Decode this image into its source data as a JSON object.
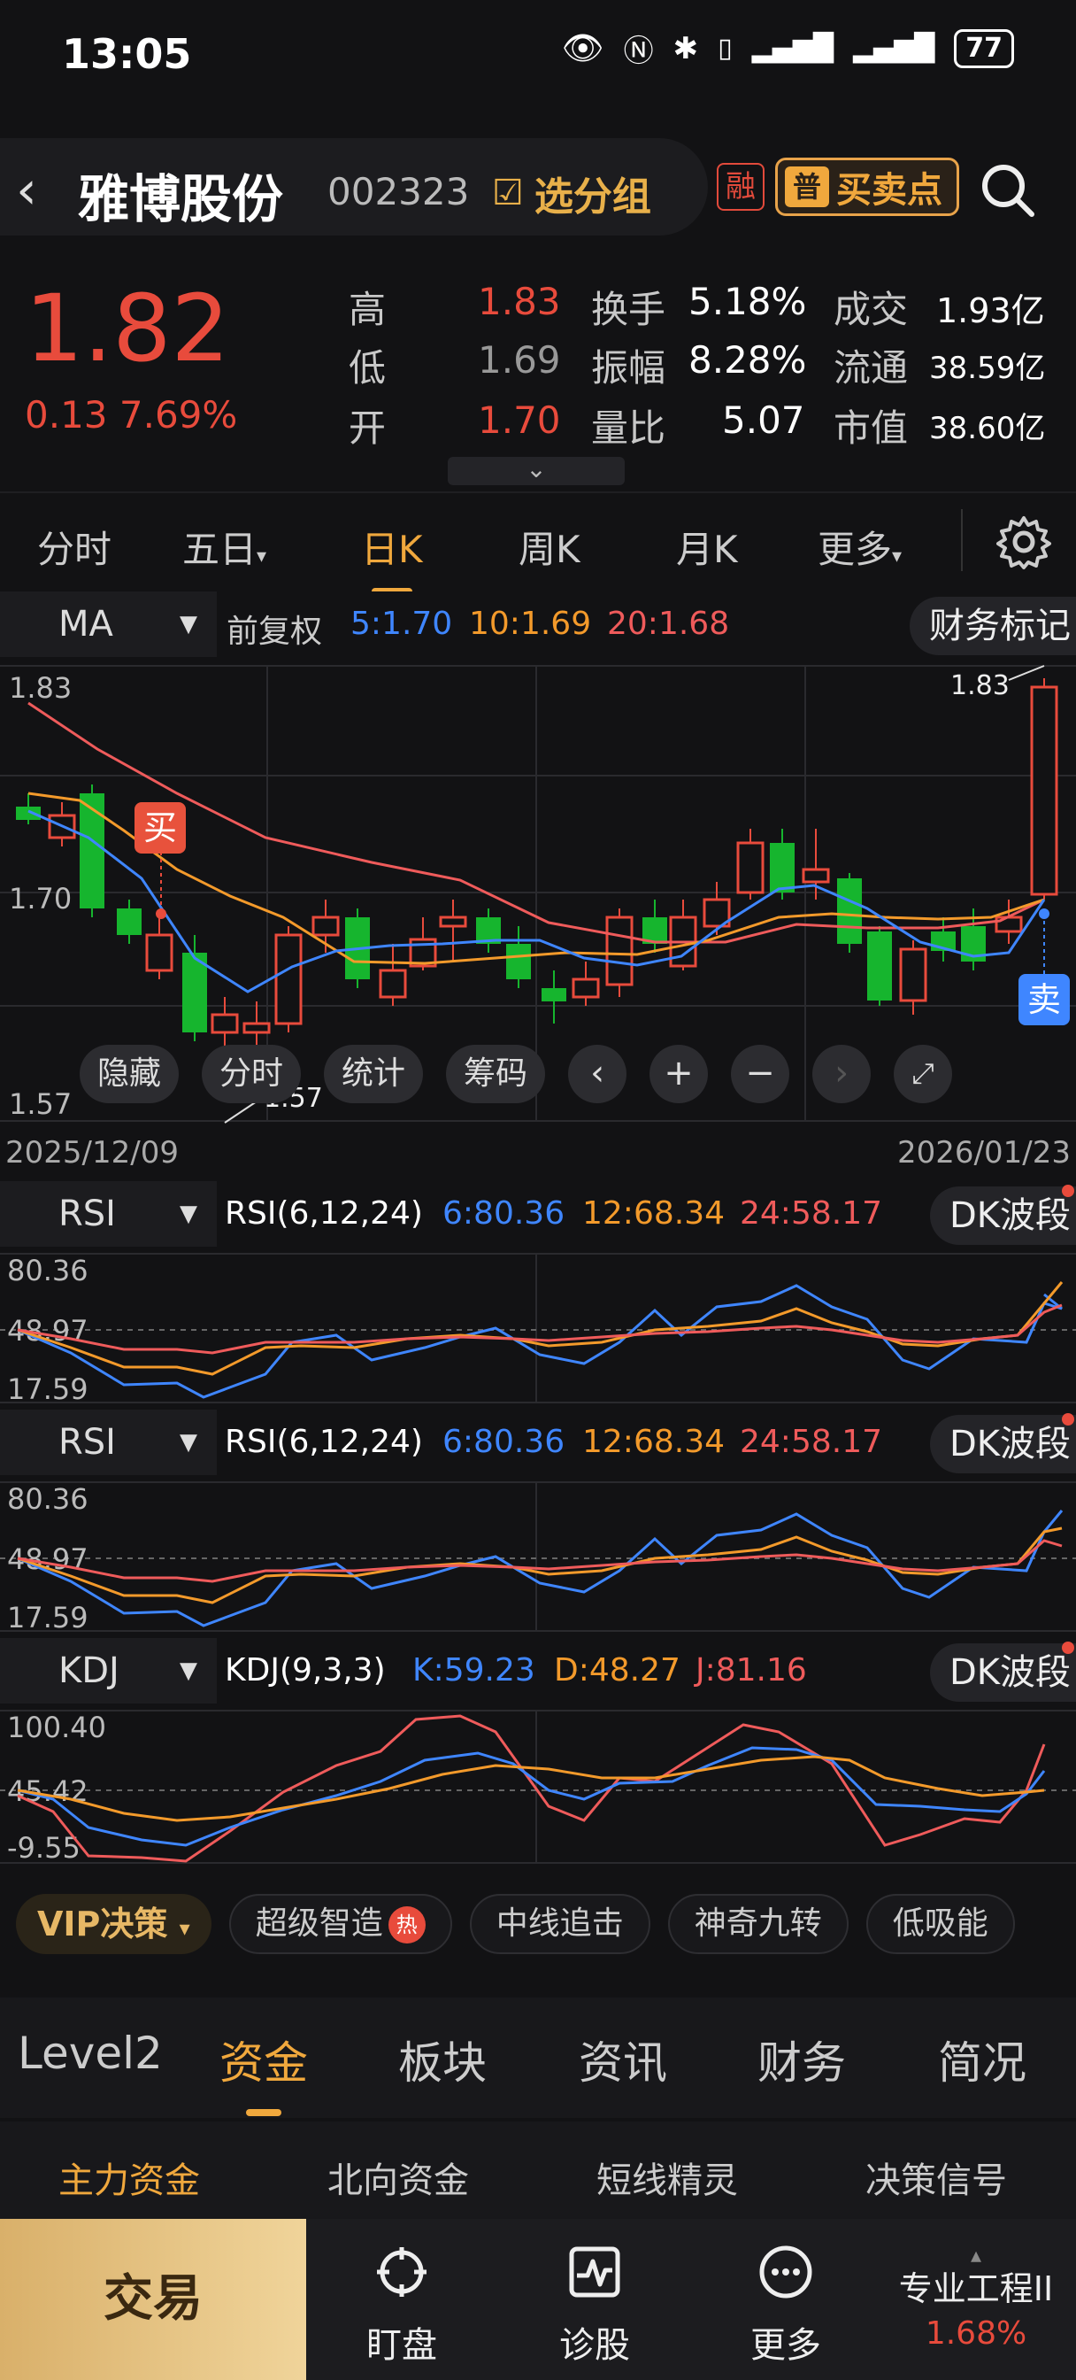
{
  "status_bar": {
    "time": "13:05",
    "battery": "77"
  },
  "header": {
    "stock_name": "雅博股份",
    "stock_code": "002323",
    "group_button": "选分组",
    "margin_badge": "融",
    "buy_sell_points_button": "买卖点",
    "buy_sell_points_icon": "普"
  },
  "quote": {
    "price": "1.82",
    "change": "0.13",
    "change_pct": "7.69%",
    "rows": [
      [
        {
          "label": "高",
          "value": "1.83",
          "color": "red"
        },
        {
          "label": "换手",
          "value": "5.18%"
        },
        {
          "label": "成交",
          "value": "1.93亿"
        }
      ],
      [
        {
          "label": "低",
          "value": "1.69",
          "color": "white"
        },
        {
          "label": "振幅",
          "value": "8.28%"
        },
        {
          "label": "流通",
          "value": "38.59亿"
        }
      ],
      [
        {
          "label": "开",
          "value": "1.70",
          "color": "red"
        },
        {
          "label": "量比",
          "value": "5.07"
        },
        {
          "label": "市值",
          "value": "38.60亿"
        }
      ]
    ]
  },
  "period_tabs": {
    "items": [
      "分时",
      "五日",
      "日K",
      "周K",
      "月K",
      "更多"
    ],
    "active": "日K"
  },
  "ma_panel": {
    "selector": "MA",
    "adjust": "前复权",
    "ma5": "5:1.70",
    "ma10": "10:1.69",
    "ma20": "20:1.68",
    "finance_mark_button": "财务标记",
    "ymax": "1.83",
    "ymid": "1.70",
    "ymin": "1.57",
    "high_label": "1.83",
    "low_label": "1.57",
    "date_start": "2025/12/09",
    "date_end": "2026/01/23",
    "buy_sign": "买",
    "sell_sign": "卖",
    "buttons": {
      "hide": "隐藏",
      "intraday": "分时",
      "stats": "统计",
      "chips": "筹码"
    },
    "colors": {
      "ma5": "#3f86ff",
      "ma10": "#f39a2b",
      "ma20": "#ef5b5b",
      "up": "#e84b3c",
      "down": "#16b52e"
    }
  },
  "rsi_panel_1": {
    "selector": "RSI",
    "title": "RSI(6,12,24)",
    "v6": "6:80.36",
    "v12": "12:68.34",
    "v24": "24:58.17",
    "button": "DK波段",
    "ytop": "80.36",
    "ymid": "48.97",
    "ybot": "17.59"
  },
  "rsi_panel_2": {
    "selector": "RSI",
    "title": "RSI(6,12,24)",
    "v6": "6:80.36",
    "v12": "12:68.34",
    "v24": "24:58.17",
    "button": "DK波段",
    "ytop": "80.36",
    "ymid": "48.97",
    "ybot": "17.59"
  },
  "kdj_panel": {
    "selector": "KDJ",
    "title": "KDJ(9,3,3)",
    "k": "K:59.23",
    "d": "D:48.27",
    "j": "J:81.16",
    "button": "DK波段",
    "ytop": "100.40",
    "ymid": "45.42",
    "ybot": "-9.55"
  },
  "strategy_row": {
    "vip": "VIP决策",
    "hot_badge": "热",
    "chips": [
      "超级智造",
      "中线追击",
      "神奇九转",
      "低吸能"
    ]
  },
  "bottom_tabs": {
    "items": [
      "Level2",
      "资金",
      "板块",
      "资讯",
      "财务",
      "简况"
    ],
    "active": "资金"
  },
  "sub_tabs": {
    "items": [
      "主力资金",
      "北向资金",
      "短线精灵",
      "决策信号"
    ],
    "active": "主力资金"
  },
  "nav": {
    "trade": "交易",
    "watch": "盯盘",
    "diagnose": "诊股",
    "more": "更多",
    "sector_name": "专业工程II",
    "sector_change": "1.68%"
  }
}
